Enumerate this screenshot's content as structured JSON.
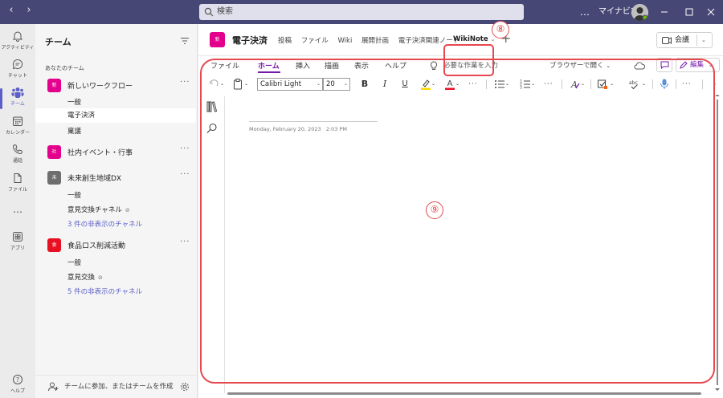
{
  "topbar": {
    "back": "‹",
    "forward": "›",
    "search_placeholder": "検索",
    "more": "…",
    "org": "マイナビ365"
  },
  "rail": [
    {
      "label": "アクティビティ",
      "icon": "bell-icon"
    },
    {
      "label": "チャット",
      "icon": "chat-icon"
    },
    {
      "label": "チーム",
      "icon": "teams-icon",
      "active": true
    },
    {
      "label": "カレンダー",
      "icon": "calendar-icon"
    },
    {
      "label": "通話",
      "icon": "phone-icon"
    },
    {
      "label": "ファイル",
      "icon": "file-icon"
    },
    {
      "label": "…",
      "icon": "more-icon"
    },
    {
      "label": "アプリ",
      "icon": "apps-icon"
    },
    {
      "label": "ヘルプ",
      "icon": "help-icon"
    }
  ],
  "panel": {
    "title": "チーム",
    "section": "あなたのチーム",
    "teams": [
      {
        "abbr": "新",
        "name": "新しいワークフロー",
        "color": "#e3008c",
        "channels": [
          {
            "name": "一般"
          },
          {
            "name": "電子決済",
            "selected": true
          },
          {
            "name": "稟議"
          }
        ]
      },
      {
        "abbr": "社",
        "name": "社内イベント・行事",
        "color": "#e3008c",
        "channels": []
      },
      {
        "abbr": "未",
        "name": "未来創生地域DX",
        "color": "#6e6e6e",
        "channels": [
          {
            "name": "一般"
          },
          {
            "name": "意見交換チャネル",
            "attach": "⊘"
          },
          {
            "name": "3 件の非表示のチャネル",
            "link": true
          }
        ]
      },
      {
        "abbr": "食",
        "name": "食品ロス削減活動",
        "color": "#e81123",
        "channels": [
          {
            "name": "一般"
          },
          {
            "name": "意見交換",
            "attach": "⊘"
          },
          {
            "name": "5 件の非表示のチャネル",
            "link": true
          }
        ]
      }
    ],
    "more": "···",
    "join": "チームに参加、またはチームを作成"
  },
  "channel": {
    "icon": "新",
    "name": "電子決済",
    "tabs": [
      "投稿",
      "ファイル",
      "Wiki",
      "展開計画",
      "電子決済関連ノート"
    ],
    "active_tab": "WikiNote",
    "add": "+",
    "meet": "会議"
  },
  "ribbon": {
    "menus": [
      "ファイル",
      "ホーム",
      "挿入",
      "描画",
      "表示",
      "ヘルプ"
    ],
    "active_menu": "ホーム",
    "tell_me": "必要な作業を入力",
    "open_in_browser": "ブラウザーで開く",
    "edit": "編集",
    "font": "Calibri Light",
    "size": "20",
    "bold": "B",
    "italic": "I",
    "underline": "U",
    "more": "···"
  },
  "page": {
    "date": "Monday, February 20, 2023",
    "time": "2:03 PM"
  },
  "annotations": {
    "tab_marker": "⑧",
    "content_marker": "⑨"
  }
}
